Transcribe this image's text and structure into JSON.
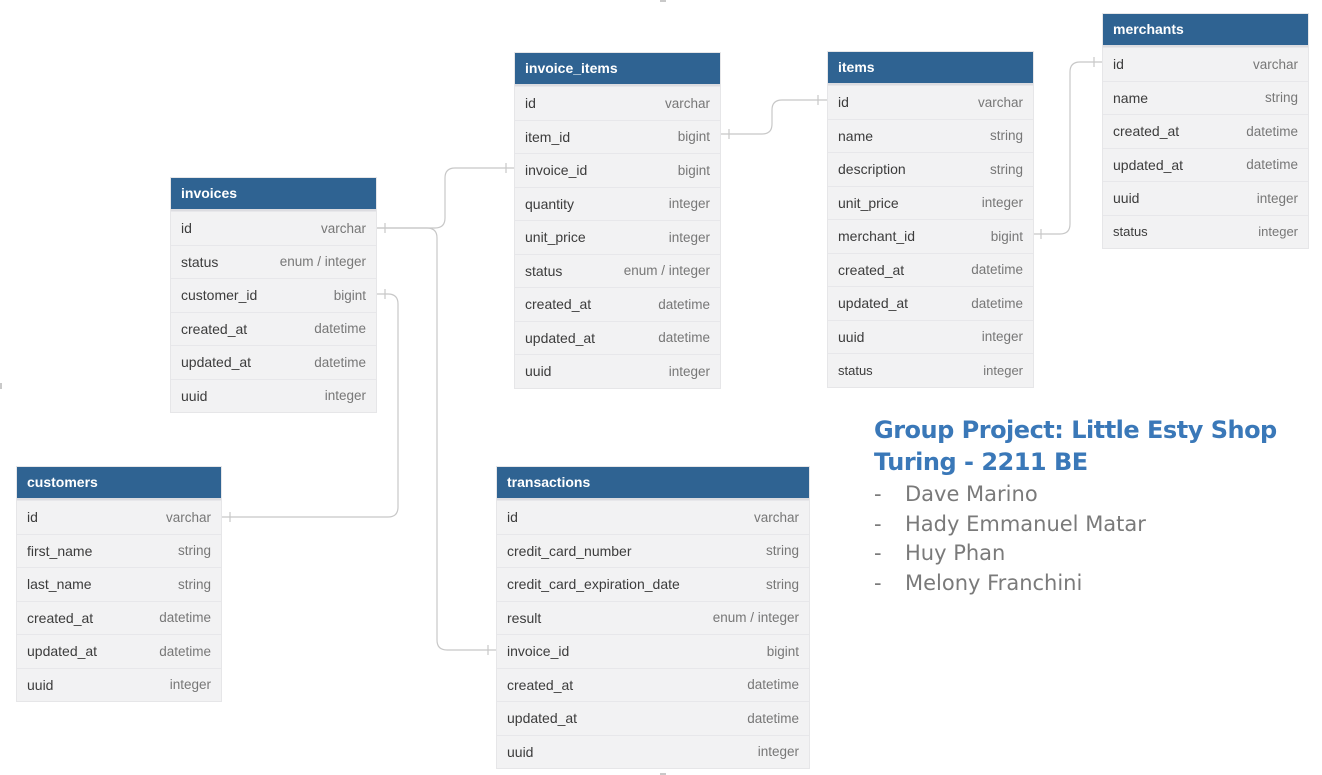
{
  "tables": [
    {
      "name": "invoice_items",
      "fields": [
        {
          "name": "id",
          "type": "varchar"
        },
        {
          "name": "item_id",
          "type": "bigint"
        },
        {
          "name": "invoice_id",
          "type": "bigint"
        },
        {
          "name": "quantity",
          "type": "integer"
        },
        {
          "name": "unit_price",
          "type": "integer"
        },
        {
          "name": "status",
          "type": "enum / integer"
        },
        {
          "name": "created_at",
          "type": "datetime"
        },
        {
          "name": "updated_at",
          "type": "datetime"
        },
        {
          "name": "uuid",
          "type": "integer"
        }
      ]
    },
    {
      "name": "items",
      "fields": [
        {
          "name": "id",
          "type": "varchar"
        },
        {
          "name": "name",
          "type": "string"
        },
        {
          "name": "description",
          "type": "string"
        },
        {
          "name": "unit_price",
          "type": "integer"
        },
        {
          "name": "merchant_id",
          "type": "bigint"
        },
        {
          "name": "created_at",
          "type": "datetime"
        },
        {
          "name": "updated_at",
          "type": "datetime"
        },
        {
          "name": "uuid",
          "type": "integer"
        },
        {
          "name": "status",
          "type": "integer"
        }
      ]
    },
    {
      "name": "merchants",
      "fields": [
        {
          "name": "id",
          "type": "varchar"
        },
        {
          "name": "name",
          "type": "string"
        },
        {
          "name": "created_at",
          "type": "datetime"
        },
        {
          "name": "updated_at",
          "type": "datetime"
        },
        {
          "name": "uuid",
          "type": "integer"
        },
        {
          "name": "status",
          "type": "integer"
        }
      ]
    },
    {
      "name": "invoices",
      "fields": [
        {
          "name": "id",
          "type": "varchar"
        },
        {
          "name": "status",
          "type": "enum / integer"
        },
        {
          "name": "customer_id",
          "type": "bigint"
        },
        {
          "name": "created_at",
          "type": "datetime"
        },
        {
          "name": "updated_at",
          "type": "datetime"
        },
        {
          "name": "uuid",
          "type": "integer"
        }
      ]
    },
    {
      "name": "customers",
      "fields": [
        {
          "name": "id",
          "type": "varchar"
        },
        {
          "name": "first_name",
          "type": "string"
        },
        {
          "name": "last_name",
          "type": "string"
        },
        {
          "name": "created_at",
          "type": "datetime"
        },
        {
          "name": "updated_at",
          "type": "datetime"
        },
        {
          "name": "uuid",
          "type": "integer"
        }
      ]
    },
    {
      "name": "transactions",
      "fields": [
        {
          "name": "id",
          "type": "varchar"
        },
        {
          "name": "credit_card_number",
          "type": "string"
        },
        {
          "name": "credit_card_expiration_date",
          "type": "string"
        },
        {
          "name": "result",
          "type": "enum / integer"
        },
        {
          "name": "invoice_id",
          "type": "bigint"
        },
        {
          "name": "created_at",
          "type": "datetime"
        },
        {
          "name": "updated_at",
          "type": "datetime"
        },
        {
          "name": "uuid",
          "type": "integer"
        }
      ]
    }
  ],
  "note": {
    "title_line1": "Group Project: Little Esty Shop",
    "title_line2": "Turing - 2211 BE",
    "members": [
      "Dave Marino",
      "Hady Emmanuel Matar",
      "Huy Phan",
      "Melony Franchini"
    ],
    "bullet": "-"
  },
  "colors": {
    "header_bg": "#2f6392",
    "table_bg": "#f2f2f3",
    "note_title": "#3a78b8",
    "note_text": "#7a7a7a",
    "connector": "#c8c8c8"
  }
}
